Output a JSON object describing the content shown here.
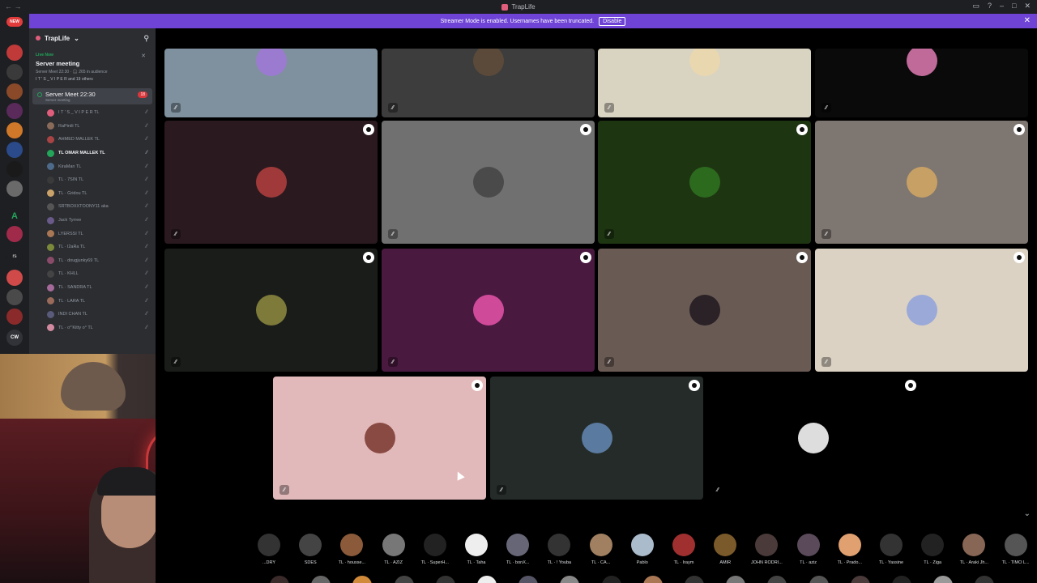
{
  "window": {
    "title": "TrapLife"
  },
  "banner": {
    "text": "Streamer Mode is enabled. Usernames have been truncated.",
    "disable_label": "Disable"
  },
  "rail": {
    "new_badge": "NEW",
    "letters": [
      "A",
      "rs",
      "CW"
    ]
  },
  "server": {
    "name": "TrapLife"
  },
  "live": {
    "label": "Live Now",
    "title": "Server meeting",
    "subtitle": "Server Meet 22:30 · 🎧 265 in audience",
    "users": "I T ' S _ V I P E R and 19 others"
  },
  "channel": {
    "name": "Server Meet 22:30",
    "subtitle": "Server meeting",
    "badge": "18"
  },
  "members": [
    {
      "name": "I T ' S _ V I P E R  TL",
      "color": "#e05e7b"
    },
    {
      "name": "RaPinili  TL",
      "color": "#8a6b5a"
    },
    {
      "name": "AHMED MALLEK  TL",
      "color": "#a84444"
    },
    {
      "name": "TL OMAR MALLEK  TL",
      "color": "#23a55a",
      "active": true
    },
    {
      "name": "KiraMan  TL",
      "color": "#4d6a8a"
    },
    {
      "name": "TL · 7SIN  TL",
      "color": "#3a3a3a"
    },
    {
      "name": "TL · Gridou  TL",
      "color": "#c9a26a"
    },
    {
      "name": "SRTBOXXTOONY11  aka",
      "color": "#555"
    },
    {
      "name": "Jack Tyrree",
      "color": "#6a5a8a"
    },
    {
      "name": "LYERSSI  TL",
      "color": "#aa7755"
    },
    {
      "name": "TL · l2aRa  TL",
      "color": "#7a8a3a"
    },
    {
      "name": "TL · dougjunky69  TL",
      "color": "#8a4a6a"
    },
    {
      "name": "TL · KHLL",
      "color": "#444"
    },
    {
      "name": "TL · SANDRA  TL",
      "color": "#a56a9a"
    },
    {
      "name": "TL · LARA  TL",
      "color": "#9a6a5a"
    },
    {
      "name": "INDI CHAN  TL",
      "color": "#5a5a7a"
    },
    {
      "name": "TL · o°'Kitty o°  TL",
      "color": "#d28aa0"
    }
  ],
  "tiles": [
    {
      "bg": "#7f919e",
      "avatar": "#9b7bd0"
    },
    {
      "bg": "#3d3d3d",
      "avatar": "#5b4a3a"
    },
    {
      "bg": "#d9d3c2",
      "avatar": "#e9d7b0"
    },
    {
      "bg": "#0a0a0a",
      "avatar": "#c06a9a"
    },
    {
      "bg": "#2a1a1f",
      "avatar": "#a03a3a"
    },
    {
      "bg": "#707070",
      "avatar": "#4a4a4a"
    },
    {
      "bg": "#1e3512",
      "avatar": "#2c6a1e"
    },
    {
      "bg": "#7e7670",
      "avatar": "#c7a066"
    },
    {
      "bg": "#1a1c1a",
      "avatar": "#7d7a3a"
    },
    {
      "bg": "#4a1940",
      "avatar": "#d04a9a"
    },
    {
      "bg": "#6a5a54",
      "avatar": "#2a2226"
    },
    {
      "bg": "#dcd2c3",
      "avatar": "#9aa9d8"
    },
    {
      "bg": "#e2b9ba",
      "avatar": "#8a4a44"
    },
    {
      "bg": "#242b28",
      "avatar": "#5a7aa0"
    },
    {
      "bg": "#000000",
      "avatar": "#dddddd"
    }
  ],
  "audience": [
    {
      "name": "...DRY",
      "color": "#333"
    },
    {
      "name": "SDES",
      "color": "#444"
    },
    {
      "name": "TL · housse...",
      "color": "#8a5a3a"
    },
    {
      "name": "TL · AZIZ",
      "color": "#777"
    },
    {
      "name": "TL · SuperH...",
      "color": "#222"
    },
    {
      "name": "TL · Taha",
      "color": "#eeeeee"
    },
    {
      "name": "TL · bonX...",
      "color": "#667"
    },
    {
      "name": "TL · ! Youba",
      "color": "#333"
    },
    {
      "name": "TL · CA...",
      "color": "#a08060"
    },
    {
      "name": "Pablo",
      "color": "#aabbcc"
    },
    {
      "name": "TL · Iraym",
      "color": "#a03030"
    },
    {
      "name": "AMIR",
      "color": "#7a5a2a"
    },
    {
      "name": "JOHN RODRI...",
      "color": "#4a3a3a"
    },
    {
      "name": "TL · aziz",
      "color": "#5a4a5a"
    },
    {
      "name": "TL · Prado...",
      "color": "#e0a070"
    },
    {
      "name": "TL · Yassine",
      "color": "#333"
    },
    {
      "name": "TL · Ziga",
      "color": "#222"
    },
    {
      "name": "TL · Araki Jh...",
      "color": "#886655"
    },
    {
      "name": "TL · TIMO L...",
      "color": "#555"
    }
  ],
  "audience_row2": [
    "#3a2a2a",
    "#666",
    "#d08a3a",
    "#444",
    "#333",
    "#eee",
    "#556",
    "#888",
    "#222",
    "#aa7755",
    "#333",
    "#777",
    "#444",
    "#555",
    "#4a3a3a",
    "#222",
    "#999",
    "#333"
  ]
}
